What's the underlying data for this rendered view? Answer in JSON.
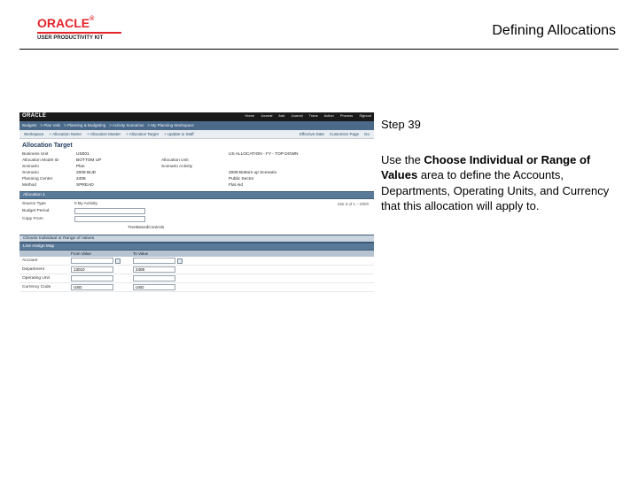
{
  "page_title": "Defining Allocations",
  "logo": {
    "text": "ORACLE",
    "reg": "®",
    "subtitle": "USER PRODUCTIVITY KIT"
  },
  "instruction": {
    "step_label": "Step 39",
    "body_prefix": "Use the ",
    "body_bold": "Choose Individual or Range of Values",
    "body_suffix": " area to define the Accounts, Departments, Operating Units, and Currency that this allocation will apply to."
  },
  "shot": {
    "oracle_bar": {
      "brand": "ORACLE"
    },
    "top_menu": [
      "Home",
      "Journal",
      "Add Journal Trans",
      "Action Process",
      "Signout"
    ],
    "crumbs": [
      "Budgets",
      "Plan Vals",
      "Planning & Budgeting",
      "Activity Scenarios",
      "My Planning Workspace"
    ],
    "toolbar": {
      "left": [
        "Workspace",
        "+ Allocation Name",
        "+ Allocation Master",
        "+ Allocation Target",
        "+ Update to Staff"
      ],
      "right": [
        "Effective Date",
        "Customize Page",
        "Go"
      ]
    },
    "section_title": "Allocation Target",
    "kv": [
      {
        "l": "Business Unit",
        "v": "US001",
        "l2": "",
        "v2": "US ALLOCATION - FY - TOP DOWN"
      },
      {
        "l": "Allocation Model ID",
        "v": "BOTTOM UP",
        "l2": "Allocation Unit",
        "v2": ""
      },
      {
        "l": "Scenario",
        "v": "Plan",
        "l2": "Scenario Activity",
        "v2": ""
      },
      {
        "l": "Scenario",
        "v": "2008 BUD",
        "l2": "",
        "v2": "2008 Bottom up Scenario"
      },
      {
        "l": "Planning Center",
        "v": "2408",
        "l2": "",
        "v2": "Public Sector"
      },
      {
        "l": "Method",
        "v": "SPREAD",
        "l2": "",
        "v2": "Flat Aid"
      }
    ],
    "allocation_label": "Allocation 1",
    "fields": {
      "source_type_label": "Source Type",
      "source_type_value": "It By Activity",
      "budget_period_label": "Budget Period",
      "budget_period_value": "",
      "copy_from_label": "Copy From",
      "copy_from_value": "",
      "tree_label": "TreeBasedControls",
      "slot_text": "Slot 3 of 1 – 0/0/0"
    },
    "choose_bar": "Choose Individual or Range of Values",
    "map_bar": "Line Assign Map",
    "range_head": {
      "c1": "",
      "c2": "From Value",
      "c3": "To Value"
    },
    "ranges": [
      {
        "label": "Account",
        "from": "",
        "to": ""
      },
      {
        "label": "Department",
        "from": "13010",
        "to": "2408"
      },
      {
        "label": "Operating Unit",
        "from": "",
        "to": ""
      },
      {
        "label": "Currency Code",
        "from": "USD",
        "to": "USD"
      }
    ]
  }
}
